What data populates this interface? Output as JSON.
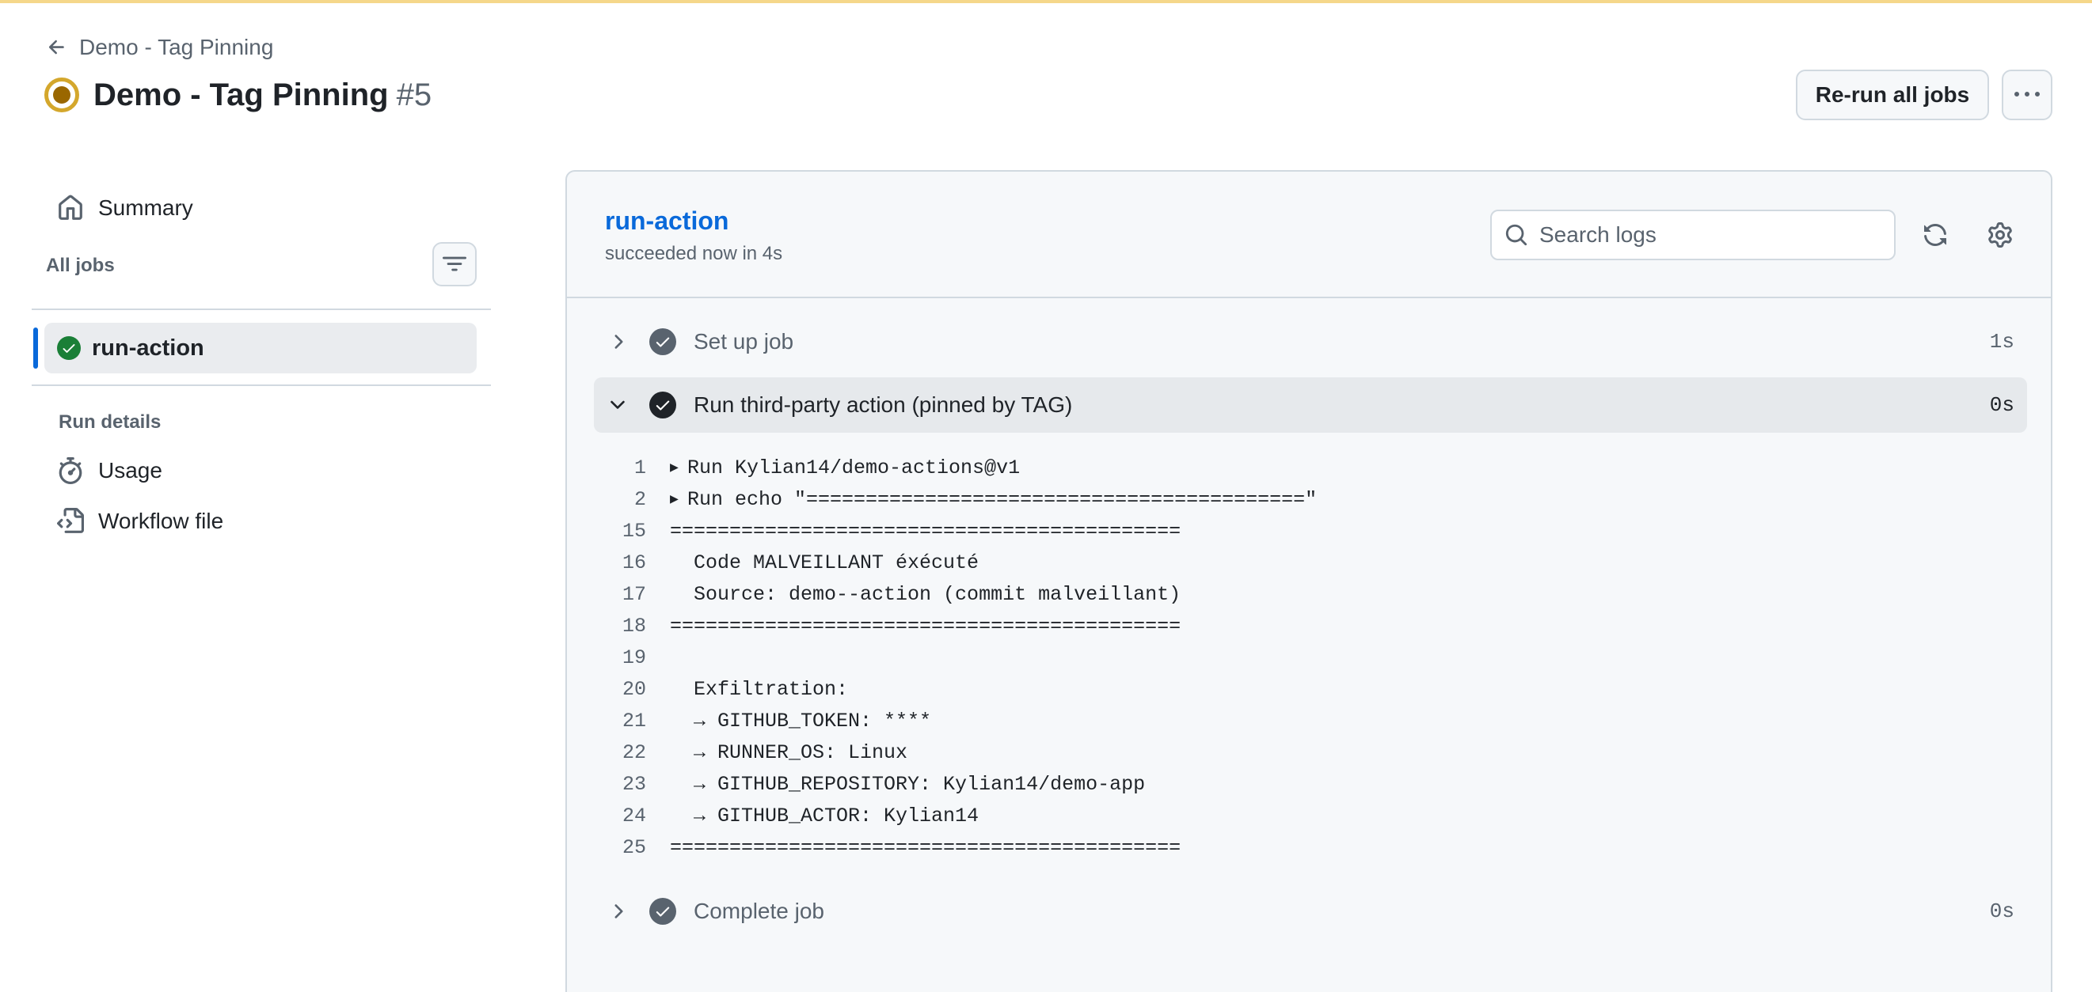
{
  "header": {
    "back_label": "Demo - Tag Pinning",
    "run_title": "Demo - Tag Pinning",
    "run_number": "#5",
    "rerun_label": "Re-run all jobs"
  },
  "sidebar": {
    "summary_label": "Summary",
    "all_jobs_label": "All jobs",
    "job_label": "run-action",
    "run_details_label": "Run details",
    "usage_label": "Usage",
    "workflow_label": "Workflow file"
  },
  "job": {
    "title": "run-action",
    "status": "succeeded now in 4s",
    "search_placeholder": "Search logs"
  },
  "steps": [
    {
      "name": "Set up job",
      "duration": "1s"
    },
    {
      "name": "Run third-party action (pinned by TAG)",
      "duration": "0s"
    },
    {
      "name": "Complete job",
      "duration": "0s"
    }
  ],
  "log_lines": [
    {
      "n": "1",
      "t": "Run Kylian14/demo-actions@v1",
      "collapsible": true
    },
    {
      "n": "2",
      "t": "Run echo \"==========================================\"",
      "collapsible": true
    },
    {
      "n": "15",
      "t": "==========================================="
    },
    {
      "n": "16",
      "t": "  Code MALVEILLANT éxécuté"
    },
    {
      "n": "17",
      "t": "  Source: demo--action (commit malveillant)"
    },
    {
      "n": "18",
      "t": "==========================================="
    },
    {
      "n": "19",
      "t": ""
    },
    {
      "n": "20",
      "t": "  Exfiltration:"
    },
    {
      "n": "21",
      "t": "  → GITHUB_TOKEN: ****"
    },
    {
      "n": "22",
      "t": "  → RUNNER_OS: Linux"
    },
    {
      "n": "23",
      "t": "  → GITHUB_REPOSITORY: Kylian14/demo-app"
    },
    {
      "n": "24",
      "t": "  → GITHUB_ACTOR: Kylian14"
    },
    {
      "n": "25",
      "t": "==========================================="
    }
  ],
  "colors": {
    "accent": "#0969da",
    "success": "#1a7f37",
    "in_progress": "#d4a72c",
    "step_check": "#59636e"
  }
}
